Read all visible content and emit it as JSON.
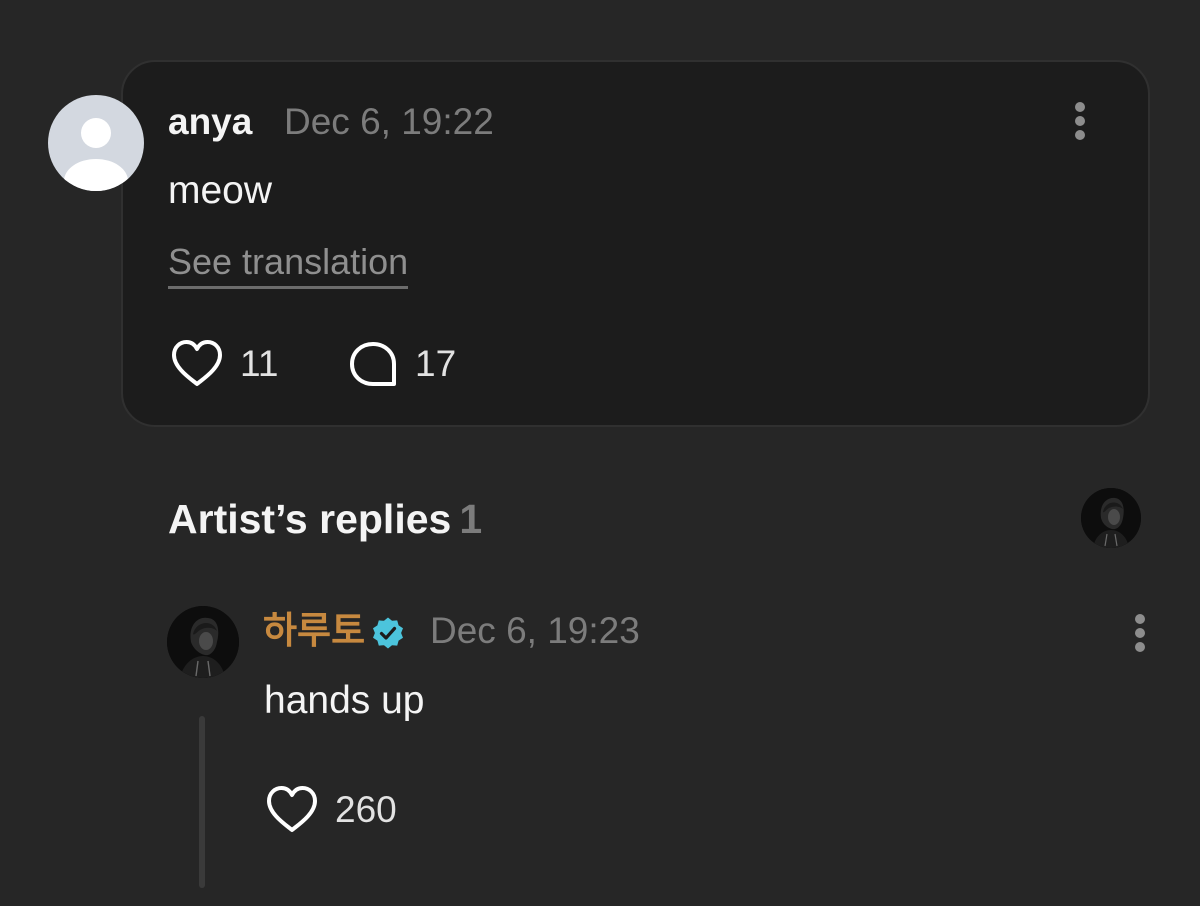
{
  "comment": {
    "author": "anya",
    "timestamp": "Dec 6, 19:22",
    "body": "meow",
    "see_translation": "See translation",
    "likes": "11",
    "replies": "17"
  },
  "artist_replies": {
    "heading": "Artist’s replies",
    "count": "1"
  },
  "reply": {
    "author": "하루토",
    "timestamp": "Dec 6, 19:23",
    "body": "hands up",
    "likes": "260"
  },
  "colors": {
    "background": "#262626",
    "card": "#1c1c1c",
    "artist_name": "#c7893f",
    "verified_badge": "#4cc4dc",
    "muted_text": "#7c7c7c"
  },
  "icons": {
    "default_avatar": "person-silhouette-icon",
    "more": "more-vertical-icon",
    "like": "heart-outline-icon",
    "comment": "speech-bubble-icon",
    "verified": "verified-badge-icon"
  }
}
